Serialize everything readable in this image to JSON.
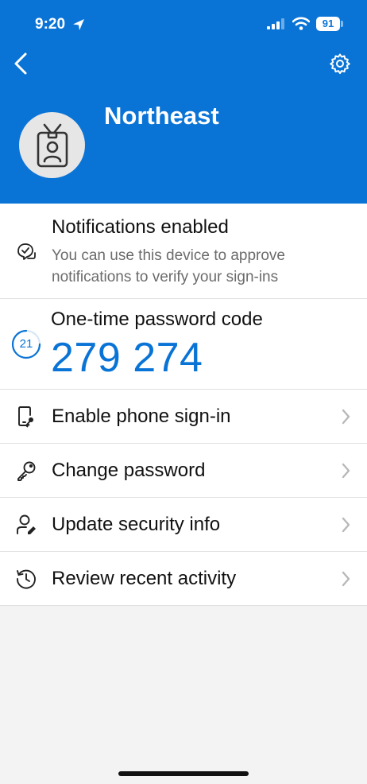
{
  "status_bar": {
    "time": "9:20",
    "battery": "91"
  },
  "header": {
    "account_name": "Northeast"
  },
  "notifications": {
    "title": "Notifications enabled",
    "description": "You can use this device to approve notifications to verify your sign-ins"
  },
  "otp": {
    "title": "One-time password code",
    "code": "279 274",
    "seconds_left": "21"
  },
  "menu": [
    {
      "label": "Enable phone sign-in",
      "icon": "phone-key-icon"
    },
    {
      "label": "Change password",
      "icon": "key-icon"
    },
    {
      "label": "Update security info",
      "icon": "person-edit-icon"
    },
    {
      "label": "Review recent activity",
      "icon": "history-icon"
    }
  ],
  "colors": {
    "accent": "#0a74d6",
    "background": "#f3f3f3"
  }
}
